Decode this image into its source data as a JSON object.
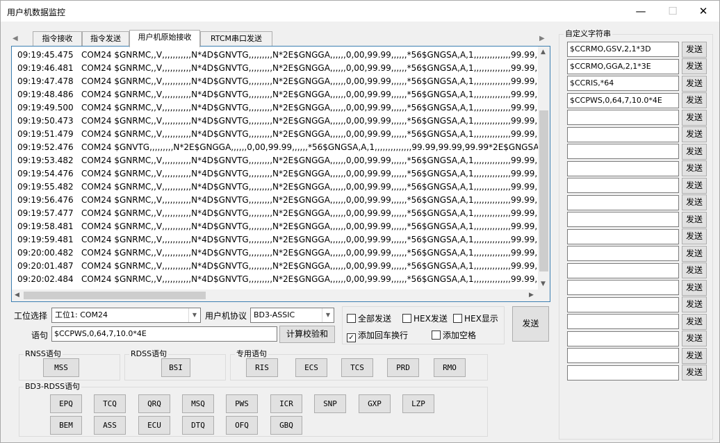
{
  "window": {
    "title": "用户机数据监控"
  },
  "tabs": [
    {
      "label": "指令接收"
    },
    {
      "label": "指令发送"
    },
    {
      "label": "用户机原始接收"
    },
    {
      "label": "RTCM串口发送"
    }
  ],
  "log_lines": [
    "09:19:45.475   COM24 $GNRMC,,V,,,,,,,,,,,N*4D$GNVTG,,,,,,,,,N*2E$GNGGA,,,,,,0,00,99.99,,,,,,*56$GNGSA,A,1,,,,,,,,,,,,,,99.99,99.",
    "09:19:46.481   COM24 $GNRMC,,V,,,,,,,,,,,N*4D$GNVTG,,,,,,,,,N*2E$GNGGA,,,,,,0,00,99.99,,,,,,*56$GNGSA,A,1,,,,,,,,,,,,,,99.99,99.",
    "09:19:47.478   COM24 $GNRMC,,V,,,,,,,,,,,N*4D$GNVTG,,,,,,,,,N*2E$GNGGA,,,,,,0,00,99.99,,,,,,*56$GNGSA,A,1,,,,,,,,,,,,,,99.99,99.",
    "09:19:48.486   COM24 $GNRMC,,V,,,,,,,,,,,N*4D$GNVTG,,,,,,,,,N*2E$GNGGA,,,,,,0,00,99.99,,,,,,*56$GNGSA,A,1,,,,,,,,,,,,,,99.99,99.",
    "09:19:49.500   COM24 $GNRMC,,V,,,,,,,,,,,N*4D$GNVTG,,,,,,,,,N*2E$GNGGA,,,,,,0,00,99.99,,,,,,*56$GNGSA,A,1,,,,,,,,,,,,,,99.99,99.",
    "09:19:50.473   COM24 $GNRMC,,V,,,,,,,,,,,N*4D$GNVTG,,,,,,,,,N*2E$GNGGA,,,,,,0,00,99.99,,,,,,*56$GNGSA,A,1,,,,,,,,,,,,,,99.99,99.",
    "09:19:51.479   COM24 $GNRMC,,V,,,,,,,,,,,N*4D$GNVTG,,,,,,,,,N*2E$GNGGA,,,,,,0,00,99.99,,,,,,*56$GNGSA,A,1,,,,,,,,,,,,,,99.99,99.",
    "09:19:52.476   COM24 $GNVTG,,,,,,,,,N*2E$GNGGA,,,,,,0,00,99.99,,,,,,*56$GNGSA,A,1,,,,,,,,,,,,,,99.99,99.99,99.99*2E$GNGSA,A",
    "09:19:53.482   COM24 $GNRMC,,V,,,,,,,,,,,N*4D$GNVTG,,,,,,,,,N*2E$GNGGA,,,,,,0,00,99.99,,,,,,*56$GNGSA,A,1,,,,,,,,,,,,,,99.99,99.",
    "09:19:54.476   COM24 $GNRMC,,V,,,,,,,,,,,N*4D$GNVTG,,,,,,,,,N*2E$GNGGA,,,,,,0,00,99.99,,,,,,*56$GNGSA,A,1,,,,,,,,,,,,,,99.99,99.",
    "09:19:55.482   COM24 $GNRMC,,V,,,,,,,,,,,N*4D$GNVTG,,,,,,,,,N*2E$GNGGA,,,,,,0,00,99.99,,,,,,*56$GNGSA,A,1,,,,,,,,,,,,,,99.99,99.",
    "09:19:56.476   COM24 $GNRMC,,V,,,,,,,,,,,N*4D$GNVTG,,,,,,,,,N*2E$GNGGA,,,,,,0,00,99.99,,,,,,*56$GNGSA,A,1,,,,,,,,,,,,,,99.99,99.",
    "09:19:57.477   COM24 $GNRMC,,V,,,,,,,,,,,N*4D$GNVTG,,,,,,,,,N*2E$GNGGA,,,,,,0,00,99.99,,,,,,*56$GNGSA,A,1,,,,,,,,,,,,,,99.99,99.",
    "09:19:58.481   COM24 $GNRMC,,V,,,,,,,,,,,N*4D$GNVTG,,,,,,,,,N*2E$GNGGA,,,,,,0,00,99.99,,,,,,*56$GNGSA,A,1,,,,,,,,,,,,,,99.99,99.",
    "09:19:59.481   COM24 $GNRMC,,V,,,,,,,,,,,N*4D$GNVTG,,,,,,,,,N*2E$GNGGA,,,,,,0,00,99.99,,,,,,*56$GNGSA,A,1,,,,,,,,,,,,,,99.99,99.",
    "09:20:00.482   COM24 $GNRMC,,V,,,,,,,,,,,N*4D$GNVTG,,,,,,,,,N*2E$GNGGA,,,,,,0,00,99.99,,,,,,*56$GNGSA,A,1,,,,,,,,,,,,,,99.99,99.",
    "09:20:01.487   COM24 $GNRMC,,V,,,,,,,,,,,N*4D$GNVTG,,,,,,,,,N*2E$GNGGA,,,,,,0,00,99.99,,,,,,*56$GNGSA,A,1,,,,,,,,,,,,,,99.99,99.",
    "09:20:02.484   COM24 $GNRMC,,V,,,,,,,,,,,N*4D$GNVTG,,,,,,,,,N*2E$GNGGA,,,,,,0,00,99.99,,,,,,*56$GNGSA,A,1,,,,,,,,,,,,,,99.99,99."
  ],
  "controls": {
    "station_label": "工位选择",
    "station_value": "工位1: COM24",
    "protocol_label": "用户机协议",
    "protocol_value": "BD3-ASSIC",
    "sentence_label": "语句",
    "sentence_value": "$CCPWS,0,64,7,10.0*4E",
    "checksum_button": "计算校验和",
    "send_button": "发送",
    "checkboxes": [
      {
        "label": "全部发送",
        "checked": false
      },
      {
        "label": "HEX发送",
        "checked": false
      },
      {
        "label": "HEX显示",
        "checked": false
      },
      {
        "label": "添加回车换行",
        "checked": true
      },
      {
        "label": "添加空格",
        "checked": false
      }
    ]
  },
  "groups": {
    "rnss": {
      "label": "RNSS语句",
      "buttons": [
        "MSS"
      ]
    },
    "rdss": {
      "label": "RDSS语句",
      "buttons": [
        "BSI"
      ]
    },
    "special": {
      "label": "专用语句",
      "buttons": [
        "RIS",
        "ECS",
        "TCS",
        "PRD",
        "RMO"
      ]
    },
    "bd3": {
      "label": "BD3-RDSS语句",
      "row1": [
        "EPQ",
        "TCQ",
        "QRQ",
        "MSQ",
        "PWS",
        "ICR",
        "SNP",
        "GXP",
        "LZP"
      ],
      "row2": [
        "BEM",
        "ASS",
        "ECU",
        "DTQ",
        "OFQ",
        "GBQ"
      ]
    }
  },
  "custom": {
    "label": "自定义字符串",
    "send_label": "发送",
    "fields": [
      "$CCRMO,GSV,2,1*3D",
      "$CCRMO,GGA,2,1*3E",
      "$CCRIS,*64",
      "$CCPWS,0,64,7,10.0*4E",
      "",
      "",
      "",
      "",
      "",
      "",
      "",
      "",
      "",
      "",
      "",
      "",
      "",
      "",
      "",
      ""
    ]
  }
}
